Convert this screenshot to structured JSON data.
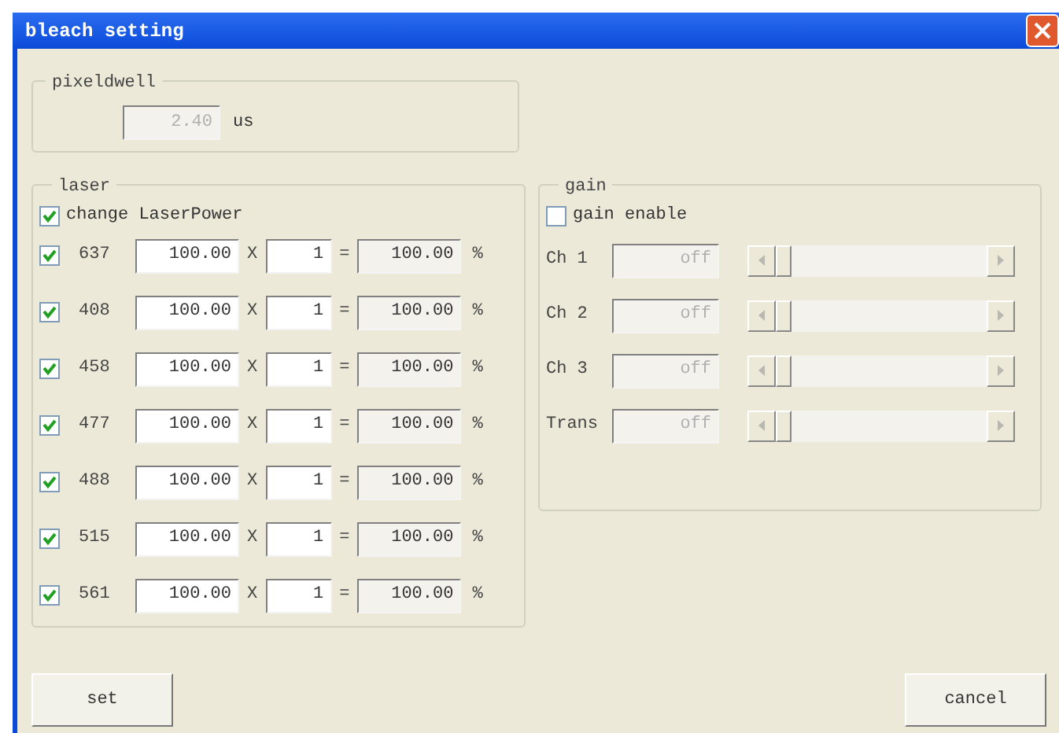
{
  "window": {
    "title": "bleach setting"
  },
  "pixeldwell": {
    "label": "pixeldwell",
    "value": "2.40",
    "unit": "us",
    "disabled": true
  },
  "laser": {
    "label": "laser",
    "change_power": {
      "label": "change LaserPower",
      "checked": true
    },
    "rows": [
      {
        "checked": true,
        "wavelength": "637",
        "power": "100.00",
        "times": "X",
        "multiplier": "1",
        "equals": "=",
        "result": "100.00",
        "unit": "%"
      },
      {
        "checked": true,
        "wavelength": "408",
        "power": "100.00",
        "times": "X",
        "multiplier": "1",
        "equals": "=",
        "result": "100.00",
        "unit": "%"
      },
      {
        "checked": true,
        "wavelength": "458",
        "power": "100.00",
        "times": "X",
        "multiplier": "1",
        "equals": "=",
        "result": "100.00",
        "unit": "%"
      },
      {
        "checked": true,
        "wavelength": "477",
        "power": "100.00",
        "times": "X",
        "multiplier": "1",
        "equals": "=",
        "result": "100.00",
        "unit": "%"
      },
      {
        "checked": true,
        "wavelength": "488",
        "power": "100.00",
        "times": "X",
        "multiplier": "1",
        "equals": "=",
        "result": "100.00",
        "unit": "%"
      },
      {
        "checked": true,
        "wavelength": "515",
        "power": "100.00",
        "times": "X",
        "multiplier": "1",
        "equals": "=",
        "result": "100.00",
        "unit": "%"
      },
      {
        "checked": true,
        "wavelength": "561",
        "power": "100.00",
        "times": "X",
        "multiplier": "1",
        "equals": "=",
        "result": "100.00",
        "unit": "%"
      }
    ]
  },
  "gain": {
    "label": "gain",
    "enable": {
      "label": "gain enable",
      "checked": false
    },
    "channels": [
      {
        "label": "Ch 1",
        "value": "off",
        "disabled": true
      },
      {
        "label": "Ch 2",
        "value": "off",
        "disabled": true
      },
      {
        "label": "Ch 3",
        "value": "off",
        "disabled": true
      },
      {
        "label": "Trans",
        "value": "off",
        "disabled": true
      }
    ]
  },
  "buttons": [
    {
      "label": "set"
    },
    {
      "label": "cancel"
    }
  ]
}
